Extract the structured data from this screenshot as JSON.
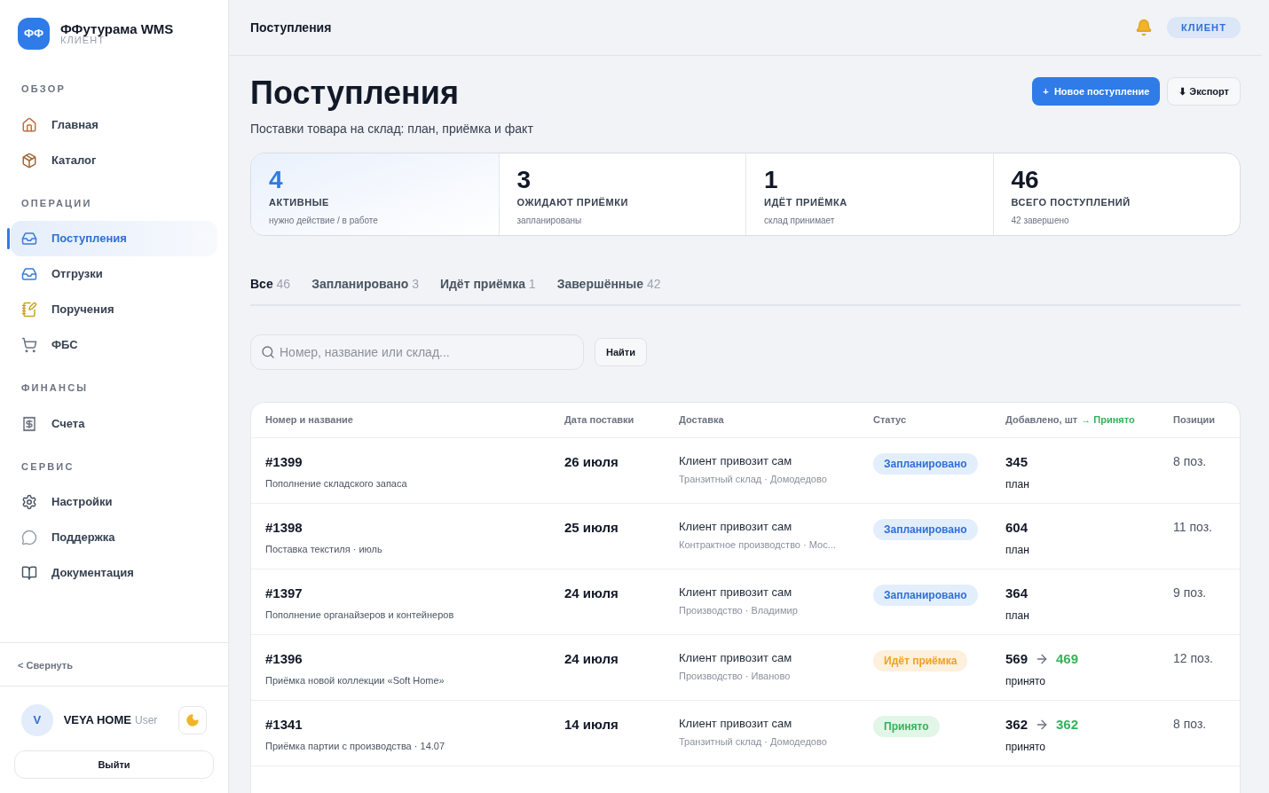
{
  "brand": {
    "logo": "ФФ",
    "name": "ФФутурама WMS",
    "role": "КЛИЕНТ"
  },
  "sidebar": {
    "sections": [
      {
        "title": "ОБЗОР",
        "items": [
          {
            "label": "Главная",
            "kind": "home",
            "selected": false
          },
          {
            "label": "Каталог",
            "kind": "box",
            "selected": false
          }
        ]
      },
      {
        "title": "ОПЕРАЦИИ",
        "items": [
          {
            "label": "Поступления",
            "kind": "inbox",
            "selected": true
          },
          {
            "label": "Отгрузки",
            "kind": "inbox",
            "selected": false
          },
          {
            "label": "Поручения",
            "kind": "note",
            "selected": false
          },
          {
            "label": "ФБС",
            "kind": "cart",
            "selected": false
          }
        ]
      },
      {
        "title": "ФИНАНСЫ",
        "items": [
          {
            "label": "Счета",
            "kind": "receipt",
            "selected": false
          }
        ]
      },
      {
        "title": "СЕРВИС",
        "items": [
          {
            "label": "Настройки",
            "kind": "gear",
            "selected": false
          },
          {
            "label": "Поддержка",
            "kind": "chat",
            "selected": false
          },
          {
            "label": "Документация",
            "kind": "book",
            "selected": false
          }
        ]
      }
    ],
    "collapse": "< Свернуть",
    "user": {
      "initial": "V",
      "name": "VEYA HOME",
      "role": "User"
    },
    "logout": "Выйти"
  },
  "topbar": {
    "title": "Поступления",
    "badge": "КЛИЕНТ"
  },
  "page": {
    "title": "Поступления",
    "subtitle": "Поставки товара на склад: план, приёмка и факт",
    "primary_button": "+  Новое поступление",
    "export_button": "⬇ Экспорт"
  },
  "stats": [
    {
      "value": "4",
      "label": "АКТИВНЫЕ",
      "note": "нужно действие / в работе",
      "selected": true
    },
    {
      "value": "3",
      "label": "ОЖИДАЮТ ПРИЁМКИ",
      "note": "запланированы",
      "selected": false
    },
    {
      "value": "1",
      "label": "ИДЁТ ПРИЁМКА",
      "note": "склад принимает",
      "selected": false
    },
    {
      "value": "46",
      "label": "ВСЕГО ПОСТУПЛЕНИЙ",
      "note": "42 завершено",
      "selected": false
    }
  ],
  "tabs": [
    {
      "label": "Все",
      "count": "46",
      "selected": true
    },
    {
      "label": "Запланировано",
      "count": "3",
      "selected": false
    },
    {
      "label": "Идёт приёмка",
      "count": "1",
      "selected": false
    },
    {
      "label": "Завершённые",
      "count": "42",
      "selected": false
    }
  ],
  "search": {
    "placeholder": "Номер, название или склад...",
    "button": "Найти"
  },
  "table": {
    "columns": [
      "Номер и название",
      "Дата поставки",
      "Доставка",
      "Статус",
      "Добавлено, шт",
      "→ Принято",
      "Позиции"
    ],
    "rows": [
      {
        "number": "#1399",
        "name": "Пополнение складского запаса",
        "date": "26 июля",
        "delivery": "Клиент привозит сам",
        "warehouse": "Транзитный склад · Домодедово",
        "status": "Запланировано",
        "kind": "planned",
        "added": "345",
        "accepted": null,
        "qty_note": "план",
        "positions": "8 поз."
      },
      {
        "number": "#1398",
        "name": "Поставка текстиля · июль",
        "date": "25 июля",
        "delivery": "Клиент привозит сам",
        "warehouse": "Контрактное производство · Мос...",
        "status": "Запланировано",
        "kind": "planned",
        "added": "604",
        "accepted": null,
        "qty_note": "план",
        "positions": "11 поз."
      },
      {
        "number": "#1397",
        "name": "Пополнение органайзеров и контейнеров",
        "date": "24 июля",
        "delivery": "Клиент привозит сам",
        "warehouse": "Производство · Владимир",
        "status": "Запланировано",
        "kind": "planned",
        "added": "364",
        "accepted": null,
        "qty_note": "план",
        "positions": "9 поз."
      },
      {
        "number": "#1396",
        "name": "Приёмка новой коллекции «Soft Home»",
        "date": "24 июля",
        "delivery": "Клиент привозит сам",
        "warehouse": "Производство · Иваново",
        "status": "Идёт приёмка",
        "kind": "receiving",
        "added": "569",
        "accepted": "469",
        "qty_note": "принято",
        "positions": "12 поз."
      },
      {
        "number": "#1341",
        "name": "Приёмка партии с производства · 14.07",
        "date": "14 июля",
        "delivery": "Клиент привозит сам",
        "warehouse": "Транзитный склад · Домодедово",
        "status": "Принято",
        "kind": "accepted",
        "added": "362",
        "accepted": "362",
        "qty_note": "принято",
        "positions": "8 поз."
      }
    ]
  }
}
